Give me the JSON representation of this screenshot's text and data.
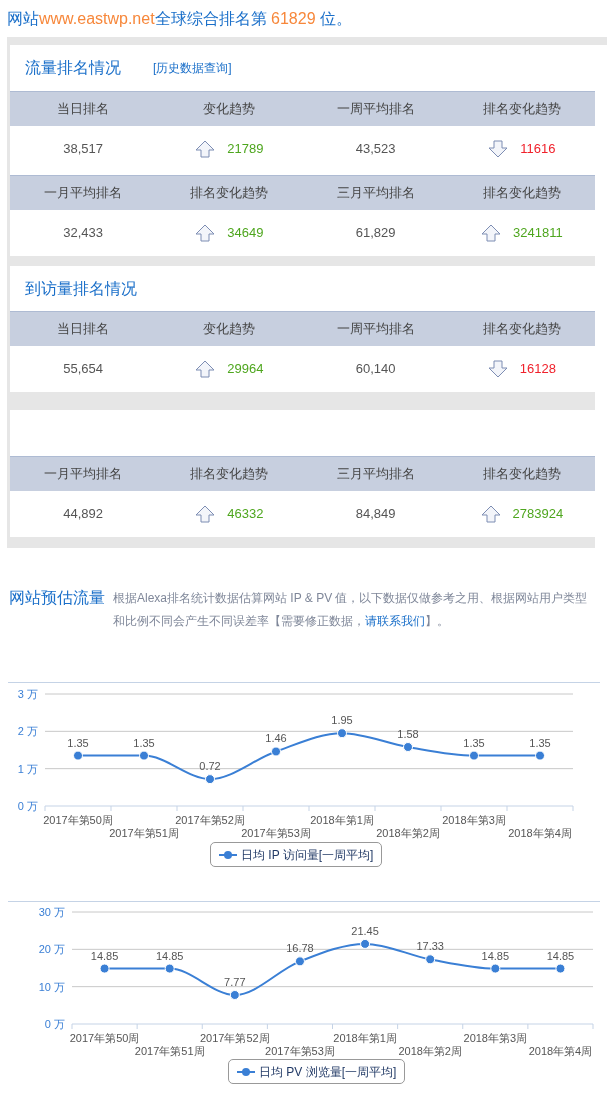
{
  "header": {
    "parts": [
      {
        "kind": "plain",
        "text": "网站"
      },
      {
        "kind": "highlight",
        "text": "www.eastwp.net"
      },
      {
        "kind": "plain",
        "text": "全球综合排名第 "
      },
      {
        "kind": "highlight",
        "text": "61829"
      },
      {
        "kind": "plain",
        "text": " 位。"
      }
    ]
  },
  "sections": [
    {
      "title": "流量排名情况",
      "link": "[历史数据查询]",
      "tables": [
        {
          "columns": [
            "当日排名",
            "变化趋势",
            "一周平均排名",
            "排名变化趋势"
          ],
          "cells": [
            {
              "kind": "rank",
              "text": "38,517"
            },
            {
              "kind": "trend",
              "rising": true,
              "text": "21789"
            },
            {
              "kind": "rank",
              "text": "43,523"
            },
            {
              "kind": "trend",
              "rising": false,
              "text": "11616"
            }
          ]
        },
        {
          "columns": [
            "一月平均排名",
            "排名变化趋势",
            "三月平均排名",
            "排名变化趋势"
          ],
          "cells": [
            {
              "kind": "rank",
              "text": "32,433"
            },
            {
              "kind": "trend",
              "rising": true,
              "text": "34649"
            },
            {
              "kind": "rank",
              "text": "61,829"
            },
            {
              "kind": "trend",
              "rising": true,
              "text": "3241811"
            }
          ]
        }
      ]
    },
    {
      "title": "到访量排名情况",
      "tables": [
        {
          "columns": [
            "当日排名",
            "变化趋势",
            "一周平均排名",
            "排名变化趋势"
          ],
          "cells": [
            {
              "kind": "rank",
              "text": "55,654"
            },
            {
              "kind": "trend",
              "rising": true,
              "text": "29964"
            },
            {
              "kind": "rank",
              "text": "60,140"
            },
            {
              "kind": "trend",
              "rising": false,
              "text": "16128"
            }
          ]
        },
        {
          "columns": [
            "一月平均排名",
            "排名变化趋势",
            "三月平均排名",
            "排名变化趋势"
          ],
          "cells": [
            {
              "kind": "rank",
              "text": "44,892"
            },
            {
              "kind": "trend",
              "rising": true,
              "text": "46332"
            },
            {
              "kind": "rank",
              "text": "84,849"
            },
            {
              "kind": "trend",
              "rising": true,
              "text": "2783924"
            }
          ]
        }
      ]
    }
  ],
  "estimate": {
    "title": "网站预估流量",
    "description": [
      {
        "kind": "plain",
        "text": "根据Alexa排名统计数据估算网站 IP & PV 值，以下数据仅做参考之用、根据网站用户类型和比例不同会产生不同误差率【需要修正数据，"
      },
      {
        "kind": "link",
        "text": "请联系我们"
      },
      {
        "kind": "plain",
        "text": "】。"
      }
    ],
    "charts": [
      {
        "chart_data": {
          "type": "line",
          "categories": [
            "2017年第50周",
            "2017年第51周",
            "2017年第52周",
            "2017年第53周",
            "2018年第1周",
            "2018年第2周",
            "2018年第3周",
            "2018年第4周"
          ],
          "series": [
            {
              "name": "日均 IP 访问量[一周平均]",
              "color": "#3a7fd5",
              "marker": true,
              "values": [
                1.35,
                1.35,
                0.72,
                1.46,
                1.95,
                1.58,
                1.35,
                1.35
              ]
            }
          ],
          "ylim": [
            0,
            3
          ],
          "yticks": [
            {
              "value": 0,
              "label": "0 万"
            },
            {
              "value": 1,
              "label": "1 万"
            },
            {
              "value": 2,
              "label": "2 万"
            },
            {
              "value": 3,
              "label": "3 万"
            }
          ],
          "data_labels": true
        }
      },
      {
        "chart_data": {
          "type": "line",
          "categories": [
            "2017年第50周",
            "2017年第51周",
            "2017年第52周",
            "2017年第53周",
            "2018年第1周",
            "2018年第2周",
            "2018年第3周",
            "2018年第4周"
          ],
          "series": [
            {
              "name": "日均 PV 浏览量[一周平均]",
              "color": "#3a7fd5",
              "marker": true,
              "values": [
                14.85,
                14.85,
                7.77,
                16.78,
                21.45,
                17.33,
                14.85,
                14.85
              ]
            }
          ],
          "ylim": [
            0,
            30
          ],
          "yticks": [
            {
              "value": 0,
              "label": "0 万"
            },
            {
              "value": 10,
              "label": "10 万"
            },
            {
              "value": 20,
              "label": "20 万"
            },
            {
              "value": 30,
              "label": "30 万"
            }
          ],
          "data_labels": true
        }
      }
    ]
  }
}
